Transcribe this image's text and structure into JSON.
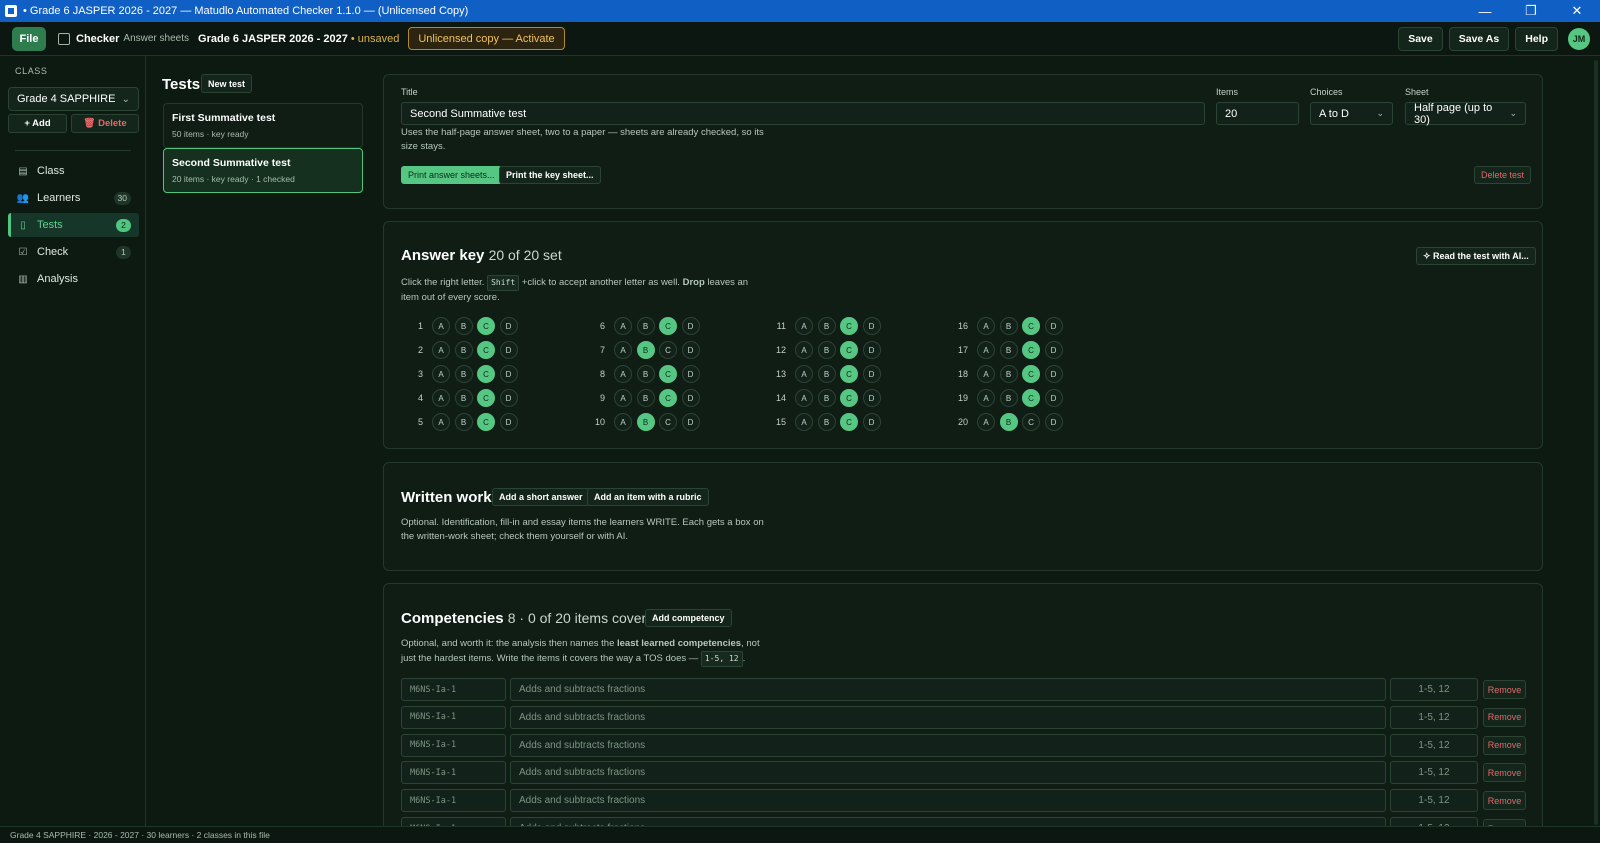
{
  "window": {
    "title": "• Grade 6 JASPER 2026 - 2027  —  Matudlo Automated Checker 1.1.0  —  (Unlicensed Copy)",
    "minimize": "—",
    "restore": "❐",
    "close": "✕"
  },
  "appbar": {
    "file": "File",
    "brand": "Checker",
    "brand_sub": "Answer sheets",
    "class_title": "Grade 6 JASPER 2026 - 2027",
    "unsaved": "• unsaved",
    "unlicensed": "Unlicensed copy — Activate",
    "save": "Save",
    "save_as": "Save As",
    "help": "Help",
    "avatar": "JM"
  },
  "sidebar": {
    "label": "CLASS",
    "class_selected": "Grade 4 SAPPHIRE",
    "add": "+ Add",
    "delete": "🗑 Delete",
    "nav": [
      {
        "label": "Class",
        "icon": "▤",
        "badge": ""
      },
      {
        "label": "Learners",
        "icon": "👥",
        "badge": "30"
      },
      {
        "label": "Tests",
        "icon": "▯",
        "badge": "2"
      },
      {
        "label": "Check",
        "icon": "☑",
        "badge": "1"
      },
      {
        "label": "Analysis",
        "icon": "▥",
        "badge": ""
      }
    ]
  },
  "tests": {
    "heading": "Tests",
    "new_test": "New test",
    "list": [
      {
        "name": "First Summative test",
        "meta": "50 items · key ready"
      },
      {
        "name": "Second Summative test",
        "meta": "20 items · key ready · 1 checked"
      }
    ]
  },
  "details": {
    "title_label": "Title",
    "title_value": "Second Summative test",
    "items_label": "Items",
    "items_value": "20",
    "choices_label": "Choices",
    "choices_value": "A to D",
    "sheet_label": "Sheet",
    "sheet_value": "Half page (up to 30)",
    "help_line1": "Uses the half-page answer sheet, two to a paper — sheets are already checked, so its",
    "help_line2": "size stays.",
    "print_answer": "Print answer sheets...",
    "print_key": "Print the key sheet...",
    "delete_test": "Delete test"
  },
  "answer_key": {
    "heading": "Answer key",
    "count": "20 of 20 set",
    "read_ai": "✧ Read the test with AI...",
    "help_a": "Click the right letter.",
    "help_kbd": "Shift",
    "help_b": "+click to accept another letter as well.",
    "help_drop": "Drop",
    "help_c": "leaves an",
    "help_line2": "item out of every score.",
    "letters": [
      "A",
      "B",
      "C",
      "D"
    ],
    "answers": [
      "C",
      "C",
      "C",
      "C",
      "C",
      "C",
      "B",
      "C",
      "C",
      "B",
      "C",
      "C",
      "C",
      "C",
      "C",
      "C",
      "C",
      "C",
      "C",
      "B"
    ]
  },
  "written": {
    "heading": "Written work",
    "add_short": "Add a short answer",
    "add_rubric": "Add an item with a rubric",
    "help_line1": "Optional. Identification, fill-in and essay items the learners WRITE. Each gets a box on",
    "help_line2": "the written-work sheet; check them yourself or with AI."
  },
  "competencies": {
    "heading": "Competencies",
    "count": "8 · 0 of 20 items covered",
    "add": "Add competency",
    "help_a": "Optional, and worth it: the analysis then names the",
    "help_bold": "least learned competencies",
    "help_b": ", not",
    "help_line2": "just the hardest items. Write the items it covers the way a TOS does —",
    "help_kbd": "1-5, 12",
    "help_end": ".",
    "code_placeholder": "M6NS-Ia-1",
    "desc_placeholder": "Adds and subtracts fractions",
    "items_placeholder": "1-5, 12",
    "remove": "Remove",
    "row_count": 6
  },
  "status": {
    "text": "Grade 4 SAPPHIRE · 2026 - 2027 · 30 learners · 2 classes in this file"
  },
  "colors": {
    "accent": "#56c783",
    "background": "#0d1a12",
    "titlebar": "#0f5fc4",
    "danger": "#e26a6a",
    "warning": "#f0c15c"
  }
}
